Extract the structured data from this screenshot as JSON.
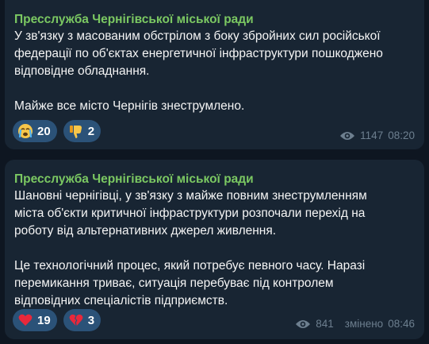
{
  "messages": [
    {
      "sender": "Пресслужба Чернігівської міської ради",
      "text": "У зв'язку з масованим обстрілом з боку збройних сил російської\nфедерації по об'єктах енергетичної інфраструктури пошкоджено\nвідповідне обладнання.\n\nМайже все місто Чернігів знеструмлено.",
      "reactions": [
        {
          "icon": "crying-face-icon",
          "count": "20"
        },
        {
          "icon": "thumbs-down-icon",
          "count": "2"
        }
      ],
      "views": "1147",
      "edited": "",
      "time": "08:20"
    },
    {
      "sender": "Пресслужба Чернігівської міської ради",
      "text": "Шановні чернігівці, у зв'язку з майже повним знеструмленням\nміста об'єкти критичної інфраструктури розпочали перехід на\nроботу від альтернативних джерел живлення.\n\nЦе технологічний процес, який потребує певного часу. Наразі\nперемикання триває, ситуація перебуває під контролем\nвідповідних спеціалістів підприємств.",
      "reactions": [
        {
          "icon": "red-heart-icon",
          "count": "19"
        },
        {
          "icon": "broken-heart-icon",
          "count": "3"
        }
      ],
      "views": "841",
      "edited": "змінено",
      "time": "08:46"
    }
  ],
  "colors": {
    "background": "#0e1621",
    "bubble": "#182533",
    "sender": "#7bc862",
    "reaction_chip": "#2b5278",
    "meta": "#6d7f8f"
  }
}
